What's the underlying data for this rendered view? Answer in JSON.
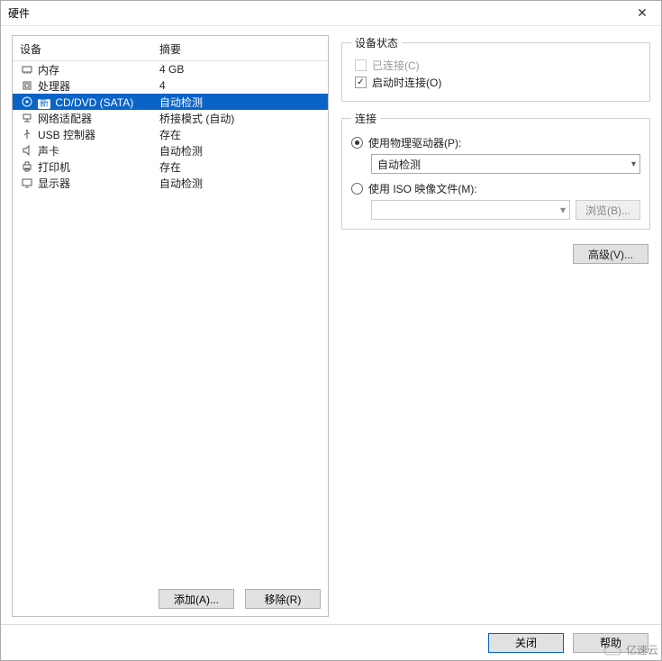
{
  "window": {
    "title": "硬件"
  },
  "list_headers": {
    "device": "设备",
    "summary": "摘要"
  },
  "devices": [
    {
      "name": "内存",
      "summary": "4 GB",
      "icon": "memory"
    },
    {
      "name": "处理器",
      "summary": "4",
      "icon": "cpu"
    },
    {
      "name": "CD/DVD (SATA)",
      "summary": "自动检测",
      "icon": "disc",
      "selected": true,
      "new_badge": "新"
    },
    {
      "name": "网络适配器",
      "summary": "桥接模式 (自动)",
      "icon": "network"
    },
    {
      "name": "USB 控制器",
      "summary": "存在",
      "icon": "usb"
    },
    {
      "name": "声卡",
      "summary": "自动检测",
      "icon": "sound"
    },
    {
      "name": "打印机",
      "summary": "存在",
      "icon": "printer"
    },
    {
      "name": "显示器",
      "summary": "自动检测",
      "icon": "display"
    }
  ],
  "left_buttons": {
    "add": "添加(A)...",
    "remove": "移除(R)"
  },
  "device_state": {
    "legend": "设备状态",
    "connected": {
      "label": "已连接(C)",
      "checked": false,
      "enabled": false
    },
    "connect_at_on": {
      "label": "启动时连接(O)",
      "checked": true
    }
  },
  "connection": {
    "legend": "连接",
    "use_physical": "使用物理驱动器(P):",
    "physical_value": "自动检测",
    "use_iso": "使用 ISO 映像文件(M):",
    "iso_value": "",
    "browse": "浏览(B)...",
    "selected": "physical"
  },
  "advanced_button": "高级(V)...",
  "bottom": {
    "close": "关闭",
    "help": "帮助"
  },
  "watermark": "亿速云"
}
